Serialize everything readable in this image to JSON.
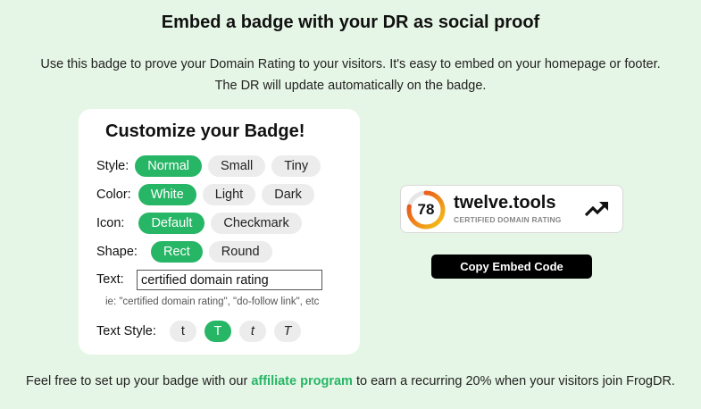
{
  "header": {
    "title": "Embed a badge with your DR as social proof",
    "subtitle_line1": "Use this badge to prove your Domain Rating to your visitors. It's easy to embed on your homepage or footer.",
    "subtitle_line2": "The DR will update automatically on the badge."
  },
  "customizer": {
    "title": "Customize your Badge!",
    "style": {
      "label": "Style:",
      "options": [
        "Normal",
        "Small",
        "Tiny"
      ],
      "selected": "Normal"
    },
    "color": {
      "label": "Color:",
      "options": [
        "White",
        "Light",
        "Dark"
      ],
      "selected": "White"
    },
    "icon": {
      "label": "Icon:",
      "options": [
        "Default",
        "Checkmark"
      ],
      "selected": "Default"
    },
    "shape": {
      "label": "Shape:",
      "options": [
        "Rect",
        "Round"
      ],
      "selected": "Rect"
    },
    "text": {
      "label": "Text:",
      "value": "certified domain rating",
      "hint": "ie: \"certified domain rating\", \"do-follow link\", etc"
    },
    "text_style": {
      "label": "Text Style:",
      "options": [
        "t",
        "T",
        "t",
        "T"
      ],
      "selected": "T"
    }
  },
  "badge": {
    "score": "78",
    "site": "twelve.tools",
    "subtitle": "CERTIFIED DOMAIN RATING",
    "score_fraction": 0.78,
    "icon": "trending-up-icon"
  },
  "actions": {
    "copy_label": "Copy Embed Code"
  },
  "footer": {
    "before": "Feel free to set up your badge with our ",
    "link": "affiliate program",
    "after": " to earn a recurring 20% when your visitors join FrogDR."
  },
  "colors": {
    "accent": "#27b566",
    "background": "#e6f6e6",
    "gauge_start": "#f5c518",
    "gauge_end": "#e8401c"
  }
}
